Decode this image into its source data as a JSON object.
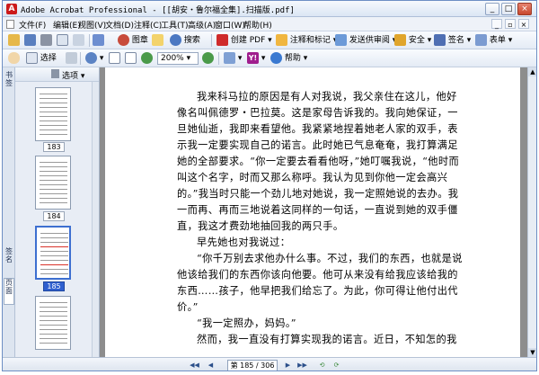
{
  "window": {
    "title": "Adobe Acrobat Professional - [[胡安・鲁尔福全集].扫描版.pdf]",
    "app_icon_letter": "A",
    "controls": {
      "minimize": "_",
      "maximize": "□",
      "close": "×"
    }
  },
  "menubar": {
    "items": [
      "文件(F)",
      "编辑(E)",
      "视图(V)",
      "文档(D)",
      "注释(C)",
      "工具(T)",
      "高级(A)",
      "窗口(W)",
      "帮助(H)"
    ],
    "doc_controls": {
      "minimize": "_",
      "restore": "▫",
      "close": "×"
    }
  },
  "toolbar1": {
    "buttons": [
      {
        "label": "",
        "icon": "open-icon"
      },
      {
        "label": "",
        "icon": "save-icon"
      },
      {
        "label": "",
        "icon": "print-icon"
      },
      {
        "label": "",
        "icon": "email-icon"
      },
      {
        "label": "",
        "icon": "attach-icon"
      },
      {
        "label": "图章",
        "icon": "stamp-icon"
      },
      {
        "label": "",
        "icon": "commenting-icon"
      },
      {
        "label": "搜索",
        "icon": "search-icon"
      },
      {
        "label": "创建 PDF",
        "icon": "create-pdf-icon"
      },
      {
        "label": "注释和标记",
        "icon": "comment-markup-icon"
      },
      {
        "label": "发送供审阅",
        "icon": "send-review-icon"
      },
      {
        "label": "安全",
        "icon": "lock-icon"
      },
      {
        "label": "签名",
        "icon": "signature-icon"
      },
      {
        "label": "表单",
        "icon": "form-icon"
      }
    ]
  },
  "toolbar2": {
    "select_label": "选择",
    "zoom_value": "200%",
    "help_label": "帮助"
  },
  "navpanel": {
    "tabs": [
      "书签",
      "签名",
      "页面"
    ],
    "options_label": "选项",
    "thumbnails": [
      {
        "label": "183",
        "selected": false
      },
      {
        "label": "184",
        "selected": false
      },
      {
        "label": "185",
        "selected": true
      },
      {
        "label": "",
        "selected": false
      }
    ]
  },
  "document": {
    "paragraphs": [
      {
        "text": "我来科马拉的原因是有人对我说，我父亲住在这儿，他好像名叫佩德罗・巴拉莫。这是家母告诉我的。我向她保证，一旦她仙逝，我即来看望他。我紧紧地捏着她老人家的双手，表示我一定要实现自己的诺言。此时她已气息奄奄，我打算满足她的全部要求。“你一定要去看看他呀，”她叮嘱我说，“他时而叫这个名字，时而又那么称呼。我认为见到你他一定会高兴的。”我当时只能一个劲儿地对她说，我一定照她说的去办。我一而再、再而三地说着这同样的一句话，一直说到她的双手僵直，我这才费劲地抽回我的两只手。",
        "indent": true
      },
      {
        "text": "早先她也对我说过：",
        "indent": true
      },
      {
        "text": "“你千万别去求他办什么事。不过，我们的东西，也就是说他该给我们的东西你该向他要。他可从来没有给我应该给我的东西……孩子，他早把我们给忘了。为此，你可得让他付出代价。”",
        "indent": true
      },
      {
        "text": "“我一定照办，妈妈。”",
        "indent": true
      },
      {
        "text": "然而，我一直没有打算实现我的诺言。近日，不知怎的我",
        "indent": true
      }
    ]
  },
  "statusbar": {
    "page_indicator": "第 185 / 306 页",
    "nav_buttons": [
      "◀◀",
      "◀",
      "▶",
      "▶▶",
      "⟲",
      "⟳"
    ]
  },
  "colors": {
    "title_bar": "#dbe6f4",
    "accent_blue": "#2f5fcf",
    "acrobat_red": "#cc1a1a"
  }
}
